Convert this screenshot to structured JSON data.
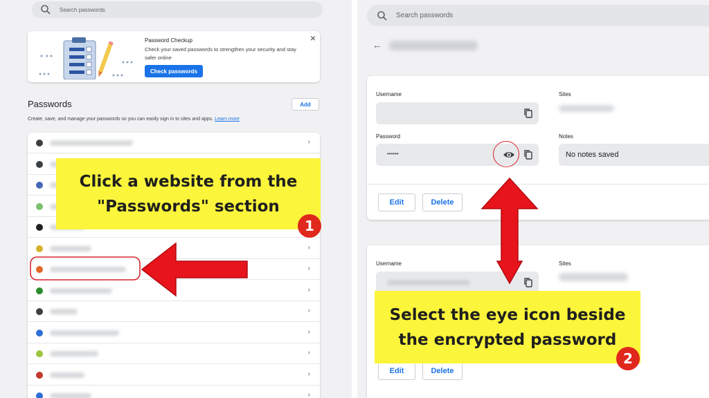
{
  "left": {
    "search_placeholder": "Search passwords",
    "checkup": {
      "title": "Password Checkup",
      "description": "Check your saved passwords to strengthen your security and stay safer online",
      "button": "Check passwords",
      "close": "×"
    },
    "section_title": "Passwords",
    "add_label": "Add",
    "section_desc": "Create, save, and manage your passwords so you can easily sign in to sites and apps.",
    "learn_more": "Learn more",
    "rows": [
      {
        "favicon": "globe-icon",
        "color": "#3c4043"
      },
      {
        "favicon": "globe-icon",
        "color": "#3c4043"
      },
      {
        "favicon": "site-icon",
        "color": "#4567b7"
      },
      {
        "favicon": "site-icon",
        "color": "#7cc06a"
      },
      {
        "favicon": "apple-icon",
        "color": "#202124"
      },
      {
        "favicon": "site-icon",
        "color": "#d5b22b"
      },
      {
        "favicon": "site-icon",
        "color": "#e2672a"
      },
      {
        "favicon": "site-icon",
        "color": "#2e8b2e"
      },
      {
        "favicon": "globe-icon",
        "color": "#3c4043"
      },
      {
        "favicon": "site-icon",
        "color": "#2d6fd6"
      },
      {
        "favicon": "site-icon",
        "color": "#9bc53d"
      },
      {
        "favicon": "site-icon",
        "color": "#c0392b"
      },
      {
        "favicon": "site-icon",
        "color": "#2d6fd6"
      }
    ],
    "chevron": "›"
  },
  "right": {
    "search_placeholder": "Search passwords",
    "back": "←",
    "card1": {
      "username_label": "Username",
      "sites_label": "Sites",
      "password_label": "Password",
      "password_value": "••••••",
      "notes_label": "Notes",
      "notes_value": "No notes saved",
      "edit": "Edit",
      "delete": "Delete"
    },
    "card2": {
      "username_label": "Username",
      "sites_label": "Sites",
      "edit": "Edit",
      "delete": "Delete"
    }
  },
  "callouts": {
    "one": {
      "text": "Click a website from the \"Passwords\" section",
      "badge": "1"
    },
    "two": {
      "text": "Select the eye icon beside the encrypted password",
      "badge": "2"
    }
  },
  "colors": {
    "accent": "#1a73e8",
    "callout": "#fbf53b",
    "arrow": "#e8141b",
    "badge": "#e0281c"
  }
}
